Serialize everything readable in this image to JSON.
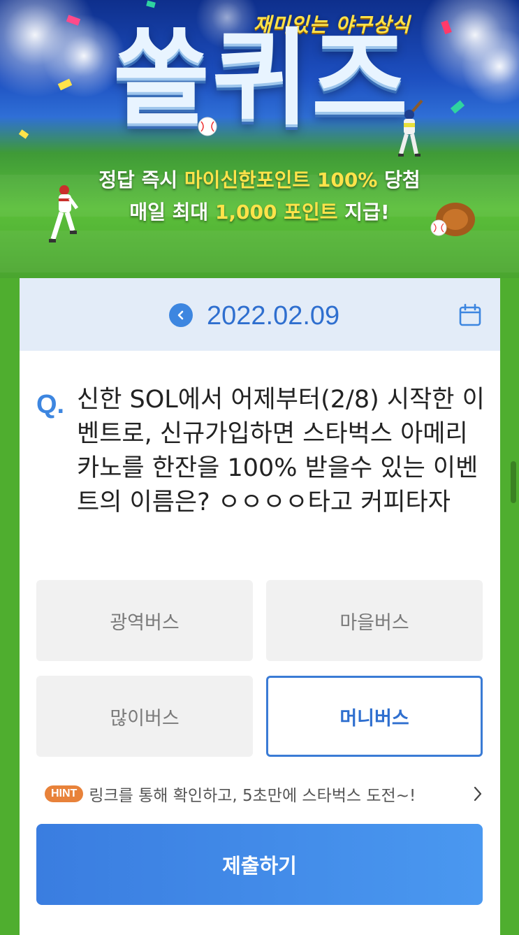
{
  "hero": {
    "tagline": "재미있는 야구상식",
    "logo": "쏠퀴즈",
    "promo_line1_pre": "정답 즉시 ",
    "promo_line1_hl": "마이신한포인트 100%",
    "promo_line1_post": " 당첨",
    "promo_line2_pre": "매일 최대 ",
    "promo_line2_hl": "1,000 포인트",
    "promo_line2_post": " 지급!"
  },
  "date_bar": {
    "date": "2022.02.09",
    "prev_icon": "chevron-left-icon",
    "calendar_icon": "calendar-icon"
  },
  "question": {
    "prefix": "Q.",
    "text": "신한 SOL에서 어제부터(2/8) 시작한 이벤트로, 신규가입하면 스타벅스 아메리카노를 한잔을 100% 받을수 있는 이벤트의 이름은? ㅇㅇㅇㅇ타고 커피타자"
  },
  "options": [
    {
      "label": "광역버스",
      "selected": false
    },
    {
      "label": "마을버스",
      "selected": false
    },
    {
      "label": "많이버스",
      "selected": false
    },
    {
      "label": "머니버스",
      "selected": true
    }
  ],
  "hint": {
    "badge": "HINT",
    "text": "링크를 통해 확인하고, 5초만에 스타벅스 도전~!"
  },
  "submit_label": "제출하기",
  "colors": {
    "accent": "#3d86e0",
    "hint_badge": "#e8823a",
    "page_green": "#4fae2f",
    "date_bar_bg": "#e3ecf8"
  }
}
